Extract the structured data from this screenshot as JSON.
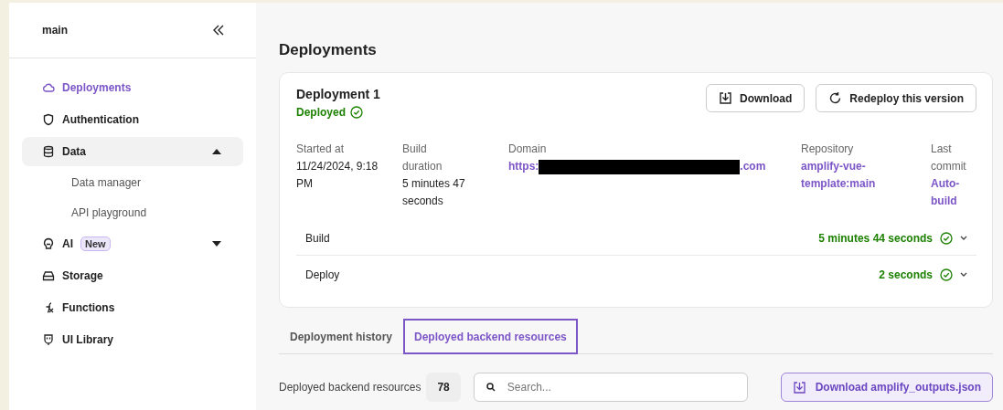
{
  "sidebar": {
    "branch": "main",
    "items": [
      {
        "label": "Deployments",
        "selected": true
      },
      {
        "label": "Authentication",
        "selected": false
      },
      {
        "label": "Data",
        "selected": false,
        "expanded": true,
        "children": [
          {
            "label": "Data manager"
          },
          {
            "label": "API playground"
          }
        ]
      },
      {
        "label": "AI",
        "selected": false,
        "expanded": false,
        "badge": "New"
      },
      {
        "label": "Storage",
        "selected": false
      },
      {
        "label": "Functions",
        "selected": false
      },
      {
        "label": "UI Library",
        "selected": false
      }
    ]
  },
  "page": {
    "title": "Deployments"
  },
  "deployment": {
    "name": "Deployment 1",
    "status": "Deployed",
    "buttons": [
      "Download",
      "Redeploy this version"
    ],
    "details": [
      {
        "kind": "text",
        "label": "Started at",
        "value": "11/24/2024, 9:18 PM"
      },
      {
        "kind": "text",
        "label": "Build duration",
        "value": "5 minutes 47 seconds"
      },
      {
        "kind": "redacted",
        "label": "Domain",
        "prefix": "https:",
        "suffix": ".com"
      },
      {
        "kind": "link",
        "label": "Repository",
        "value": "amplify-vue-template:main"
      },
      {
        "kind": "link",
        "label": "Last commit",
        "value": "Auto-build"
      }
    ],
    "steps": [
      {
        "name": "Build",
        "duration": "5 minutes 44 seconds"
      },
      {
        "name": "Deploy",
        "duration": "2 seconds"
      }
    ]
  },
  "tabs": [
    {
      "label": "Deployment history",
      "selected": false
    },
    {
      "label": "Deployed backend resources",
      "selected": true
    }
  ],
  "resources": {
    "label": "Deployed backend resources",
    "count": "78",
    "search": {
      "placeholder": "Search..."
    },
    "download": "Download amplify_outputs.json"
  }
}
